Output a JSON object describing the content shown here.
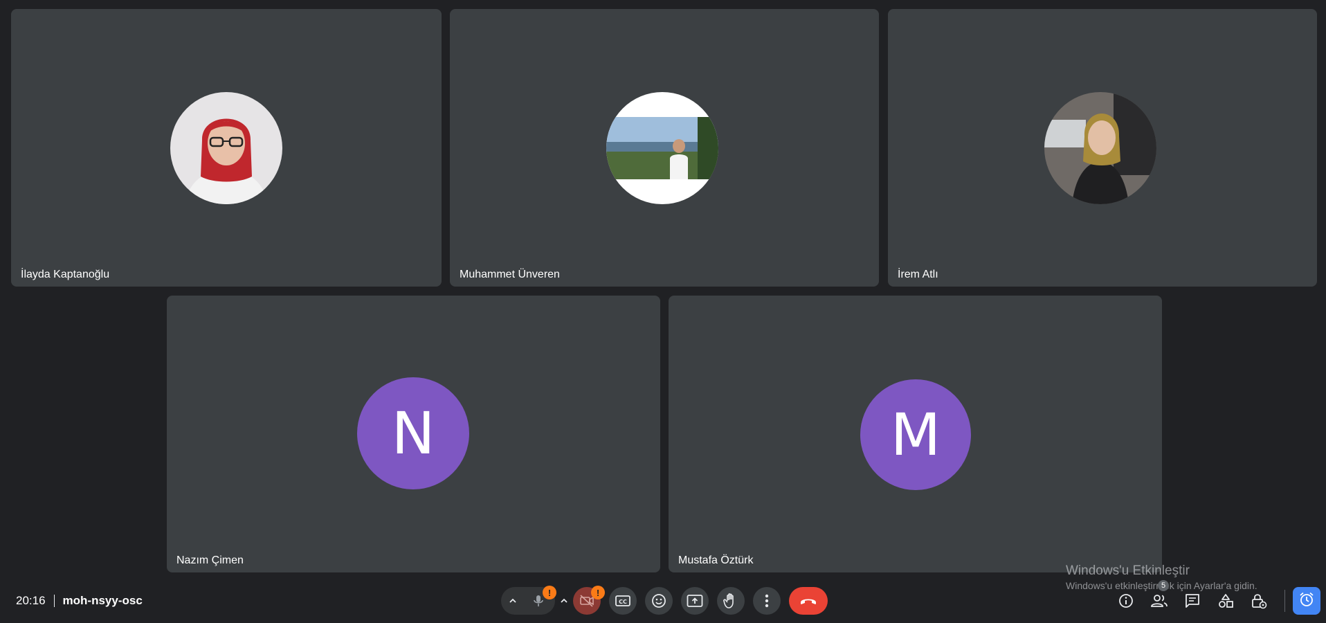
{
  "participants": [
    {
      "name": "İlayda Kaptanoğlu",
      "avatar_type": "photo"
    },
    {
      "name": "Muhammet Ünveren",
      "avatar_type": "photo"
    },
    {
      "name": "İrem Atlı",
      "avatar_type": "photo"
    },
    {
      "name": "Nazım Çimen",
      "avatar_type": "letter",
      "initial": "N",
      "color": "#7e57c2"
    },
    {
      "name": "Mustafa Öztürk",
      "avatar_type": "letter",
      "initial": "M",
      "color": "#7e57c2"
    }
  ],
  "meeting": {
    "time": "20:16",
    "code": "moh-nsyy-osc"
  },
  "controls": {
    "mic_alert": "!",
    "camera_alert": "!",
    "end_call_color": "#ea4335",
    "icons": [
      "chevron-up-icon",
      "microphone-off-icon",
      "camera-off-icon",
      "captions-icon",
      "emoji-icon",
      "present-icon",
      "raise-hand-icon",
      "more-options-icon",
      "end-call-icon"
    ]
  },
  "right_controls": {
    "people_count": "5",
    "icons": [
      "info-icon",
      "people-icon",
      "chat-icon",
      "activities-icon",
      "host-controls-icon",
      "timer-icon"
    ]
  },
  "watermark": {
    "title": "Windows'u Etkinleştir",
    "subtitle": "Windows'u etkinleştirmek için Ayarlar'a gidin."
  },
  "colors": {
    "background": "#202124",
    "tile": "#3c4043",
    "accent": "#4285f4",
    "warning": "#fa7b17"
  }
}
